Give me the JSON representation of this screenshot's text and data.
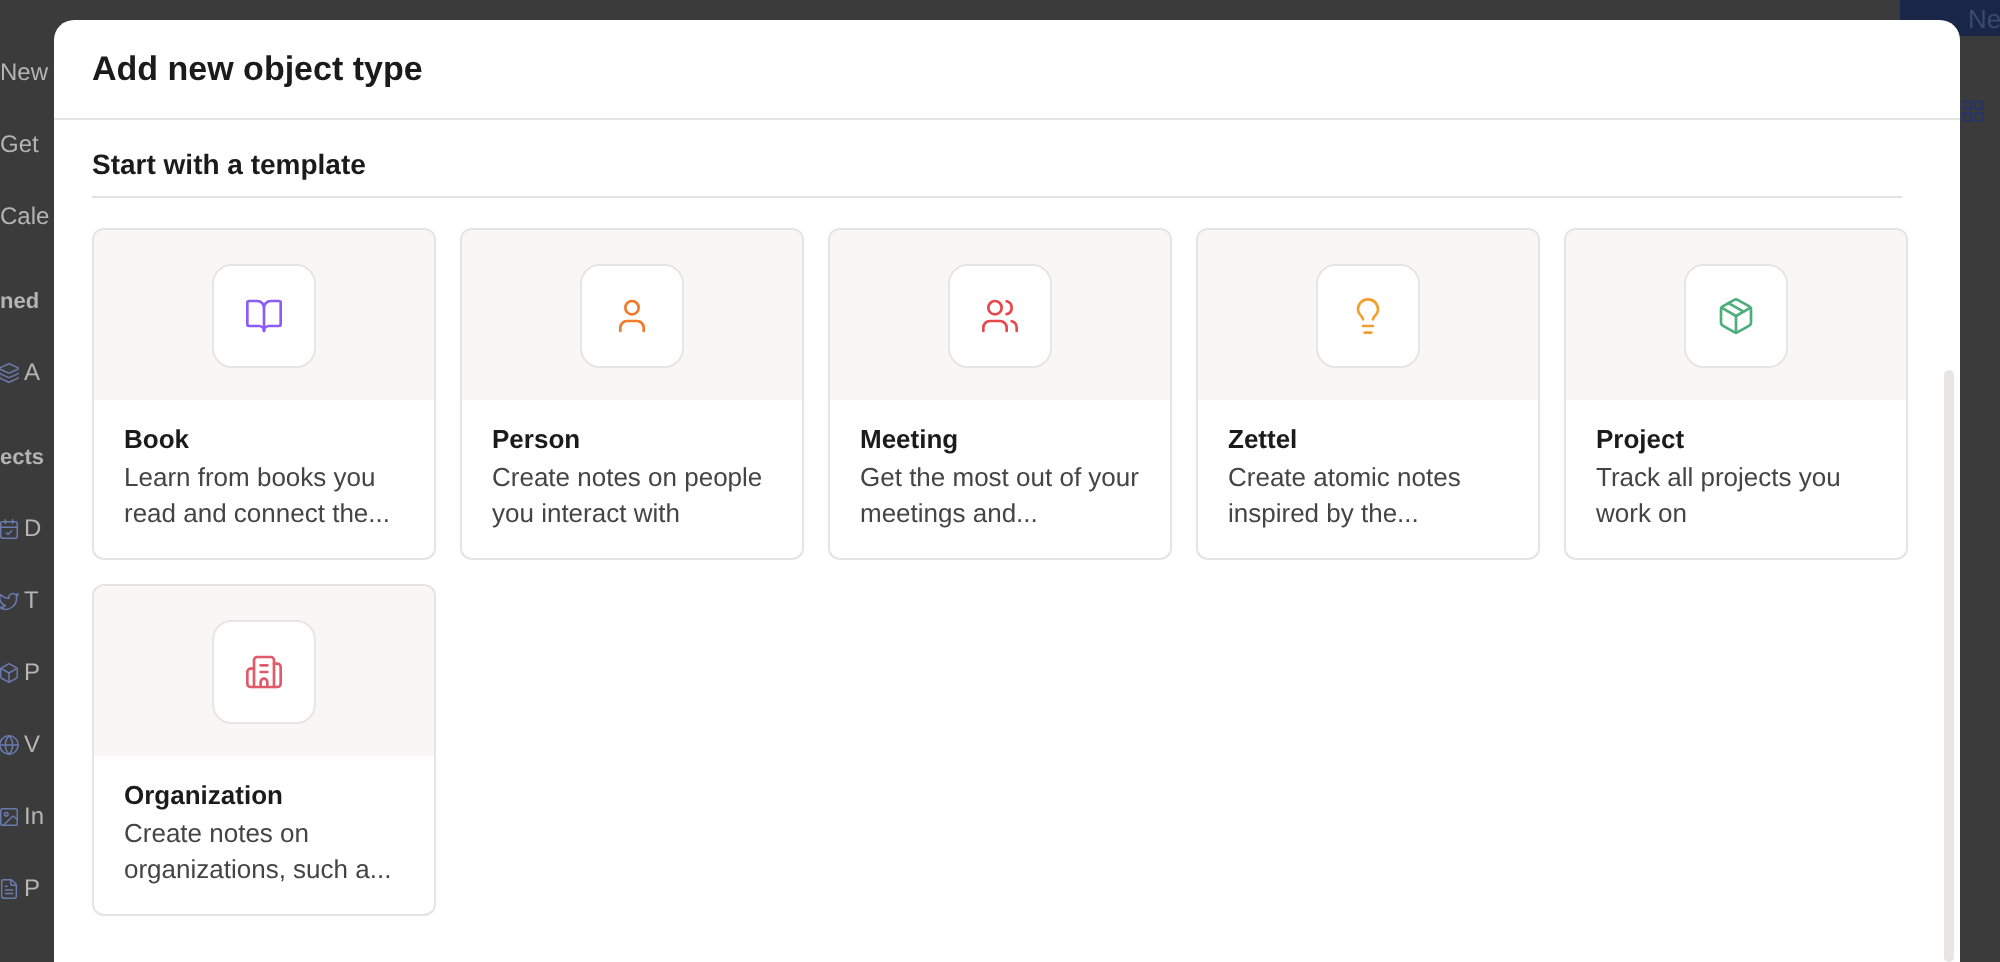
{
  "background": {
    "sidebar": [
      {
        "kind": "link",
        "label": "New"
      },
      {
        "kind": "link",
        "label": "Get"
      },
      {
        "kind": "link",
        "label": "Cale"
      },
      {
        "kind": "heading",
        "label": "ned"
      },
      {
        "kind": "item",
        "label": "A"
      },
      {
        "kind": "heading",
        "label": "ects"
      },
      {
        "kind": "item",
        "label": "D"
      },
      {
        "kind": "item",
        "label": "T"
      },
      {
        "kind": "item",
        "label": "P"
      },
      {
        "kind": "item",
        "label": "V"
      },
      {
        "kind": "item",
        "label": "In"
      },
      {
        "kind": "item",
        "label": "P"
      }
    ],
    "new_button": "Ne"
  },
  "dialog": {
    "title": "Add new object type",
    "section_title": "Start with a template",
    "templates": [
      {
        "kind": "book",
        "title": "Book",
        "description": "Learn from books you read and connect the...",
        "color": "#8b5cf6"
      },
      {
        "kind": "person",
        "title": "Person",
        "description": "Create notes on people you interact with",
        "color": "#f07a2a"
      },
      {
        "kind": "meeting",
        "title": "Meeting",
        "description": "Get the most out of your meetings and...",
        "color": "#e5484d"
      },
      {
        "kind": "zettel",
        "title": "Zettel",
        "description": "Create atomic notes inspired by the...",
        "color": "#f0a030"
      },
      {
        "kind": "project",
        "title": "Project",
        "description": "Track all projects you work on",
        "color": "#4cae7a"
      },
      {
        "kind": "organization",
        "title": "Organization",
        "description": "Create notes on organizations, such a...",
        "color": "#e05a6a"
      }
    ]
  }
}
